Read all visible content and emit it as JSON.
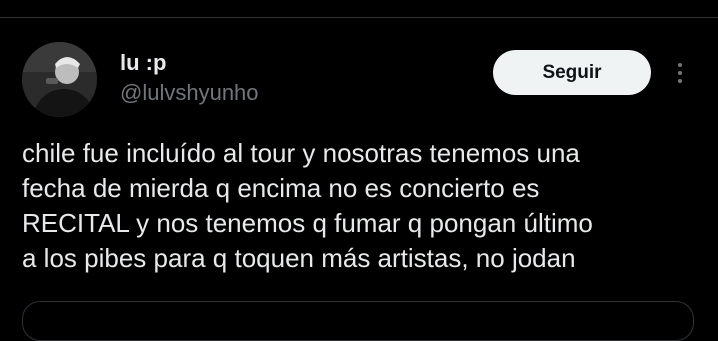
{
  "tweet": {
    "author": {
      "name": "lu :p",
      "handle": "@lulvshyunho"
    },
    "follow_label": "Seguir",
    "more_icon": "more-vertical-icon",
    "text_lines": [
      "chile fue incluído al tour y nosotras tenemos una",
      "fecha de mierda q encima no es concierto es",
      "RECITAL y nos tenemos q fumar q pongan último",
      "a los pibes para q toquen más artistas, no jodan"
    ]
  },
  "colors": {
    "background": "#000000",
    "primary_text": "#e7e9ea",
    "secondary_text": "#71767b",
    "button_bg": "#eff3f4",
    "divider": "#2f3336"
  }
}
